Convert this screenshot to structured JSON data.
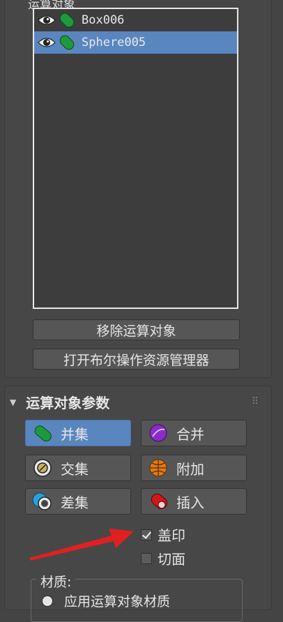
{
  "operands": {
    "header_label": "运算对象",
    "items": [
      {
        "label": "Box006",
        "selected": false
      },
      {
        "label": "Sphere005",
        "selected": true
      }
    ]
  },
  "buttons": {
    "remove_operand": "移除运算对象",
    "open_explorer": "打开布尔操作资源管理器"
  },
  "operand_params": {
    "title": "运算对象参数",
    "ops": [
      {
        "label": "并集",
        "icon": "union-icon",
        "active": true
      },
      {
        "label": "合并",
        "icon": "merge-icon",
        "active": false
      },
      {
        "label": "交集",
        "icon": "intersection-icon",
        "active": false
      },
      {
        "label": "附加",
        "icon": "attach-icon",
        "active": false
      },
      {
        "label": "差集",
        "icon": "subtraction-icon",
        "active": false
      },
      {
        "label": "插入",
        "icon": "insert-icon",
        "active": false
      }
    ],
    "imprint": {
      "label": "盖印",
      "checked": true
    },
    "cookie": {
      "label": "切面",
      "checked": false
    }
  },
  "material": {
    "title": "材质:",
    "option_label": "应用运算对象材质"
  },
  "colors": {
    "selection_blue": "#5a86c0",
    "green_pill": "#1e9a3c",
    "purple": "#8a2cc9",
    "orange": "#e07a16",
    "red": "#d01818",
    "arrow_red": "#e02020"
  }
}
